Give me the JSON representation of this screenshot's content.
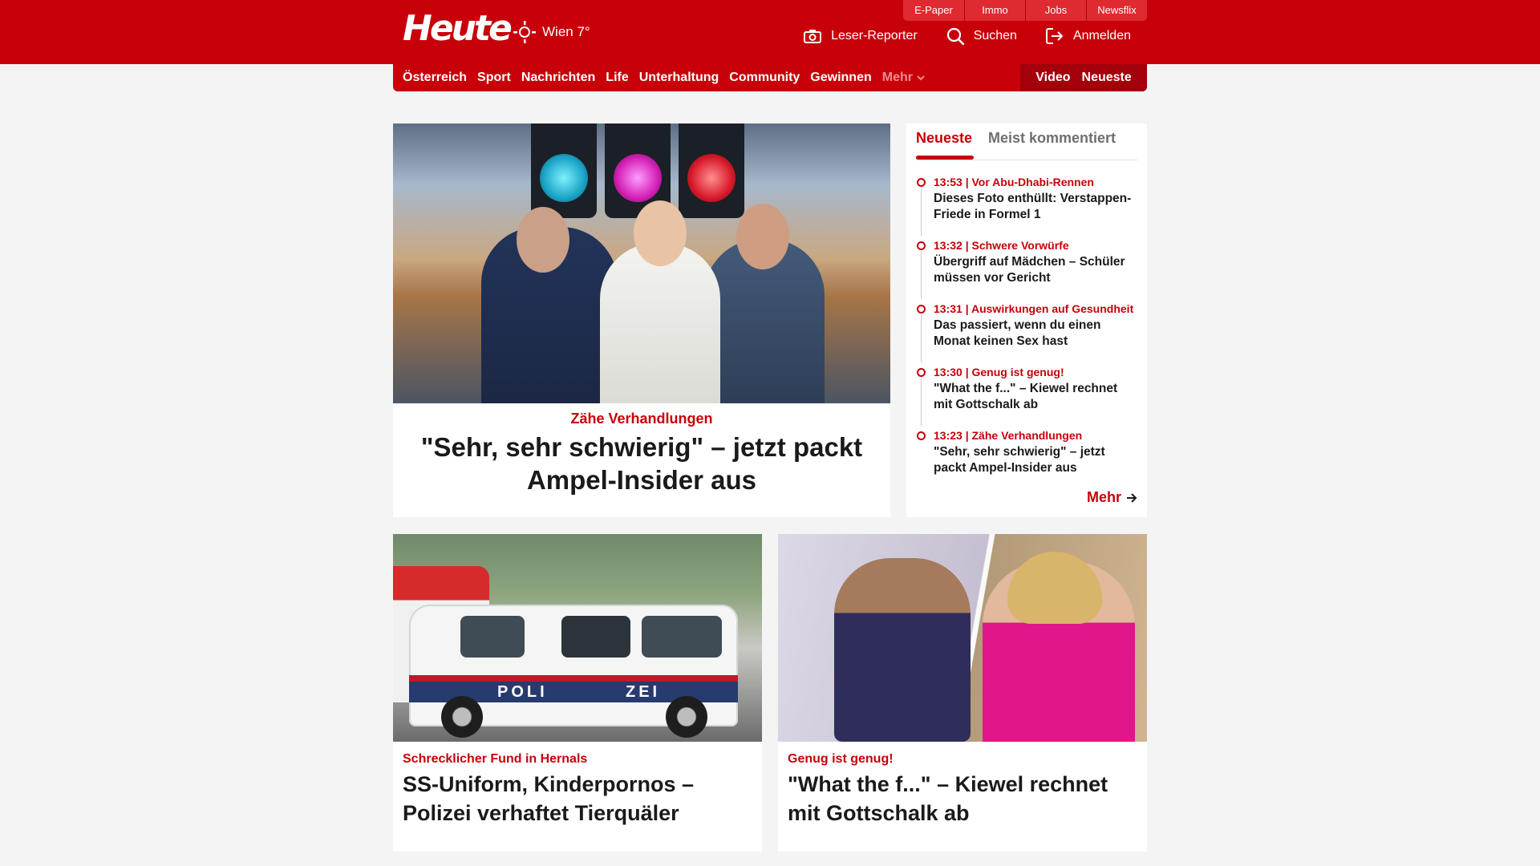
{
  "header": {
    "logo": "Heute",
    "weather": "Wien 7°",
    "top_links": [
      "E-Paper",
      "Immo",
      "Jobs",
      "Newsflix"
    ],
    "actions": {
      "reporter": "Leser-Reporter",
      "search": "Suchen",
      "login": "Anmelden"
    }
  },
  "nav": {
    "items": [
      "Österreich",
      "Sport",
      "Nachrichten",
      "Life",
      "Unterhaltung",
      "Community",
      "Gewinnen"
    ],
    "more": "Mehr",
    "video": "Video",
    "latest": "Neueste"
  },
  "hero": {
    "kicker": "Zähe Verhandlungen",
    "title": "\"Sehr, sehr schwierig\" – jetzt packt Ampel-Insider aus"
  },
  "sidebar": {
    "tab_active": "Neueste",
    "tab_inactive": "Meist kommentiert",
    "items": [
      {
        "meta": "13:53 | Vor Abu-Dhabi-Rennen",
        "title": "Dieses Foto enthüllt: Verstappen-Friede in Formel 1"
      },
      {
        "meta": "13:32 | Schwere Vorwürfe",
        "title": "Übergriff auf Mädchen – Schüler müssen vor Gericht"
      },
      {
        "meta": "13:31 | Auswirkungen auf Gesundheit",
        "title": "Das passiert, wenn du einen Monat keinen Sex hast"
      },
      {
        "meta": "13:30 | Genug ist genug!",
        "title": "\"What the f...\" – Kiewel rechnet mit Gottschalk ab"
      },
      {
        "meta": "13:23 | Zähe Verhandlungen",
        "title": "\"Sehr, sehr schwierig\" – jetzt packt Ampel-Insider aus"
      }
    ],
    "more": "Mehr"
  },
  "cards": [
    {
      "kicker": "Schrecklicher Fund in Hernals",
      "title": "SS-Uniform, Kinderpornos – Polizei verhaftet Tierquäler"
    },
    {
      "kicker": "Genug ist genug!",
      "title": "\"What the f...\" – Kiewel rechnet mit Gottschalk ab"
    }
  ],
  "image_text": {
    "van_left": "POLI",
    "van_right": "ZEI"
  },
  "colors": {
    "brand_red": "#c8000a",
    "nav_dark_red": "#a3000a",
    "background": "#f4f4f4"
  }
}
